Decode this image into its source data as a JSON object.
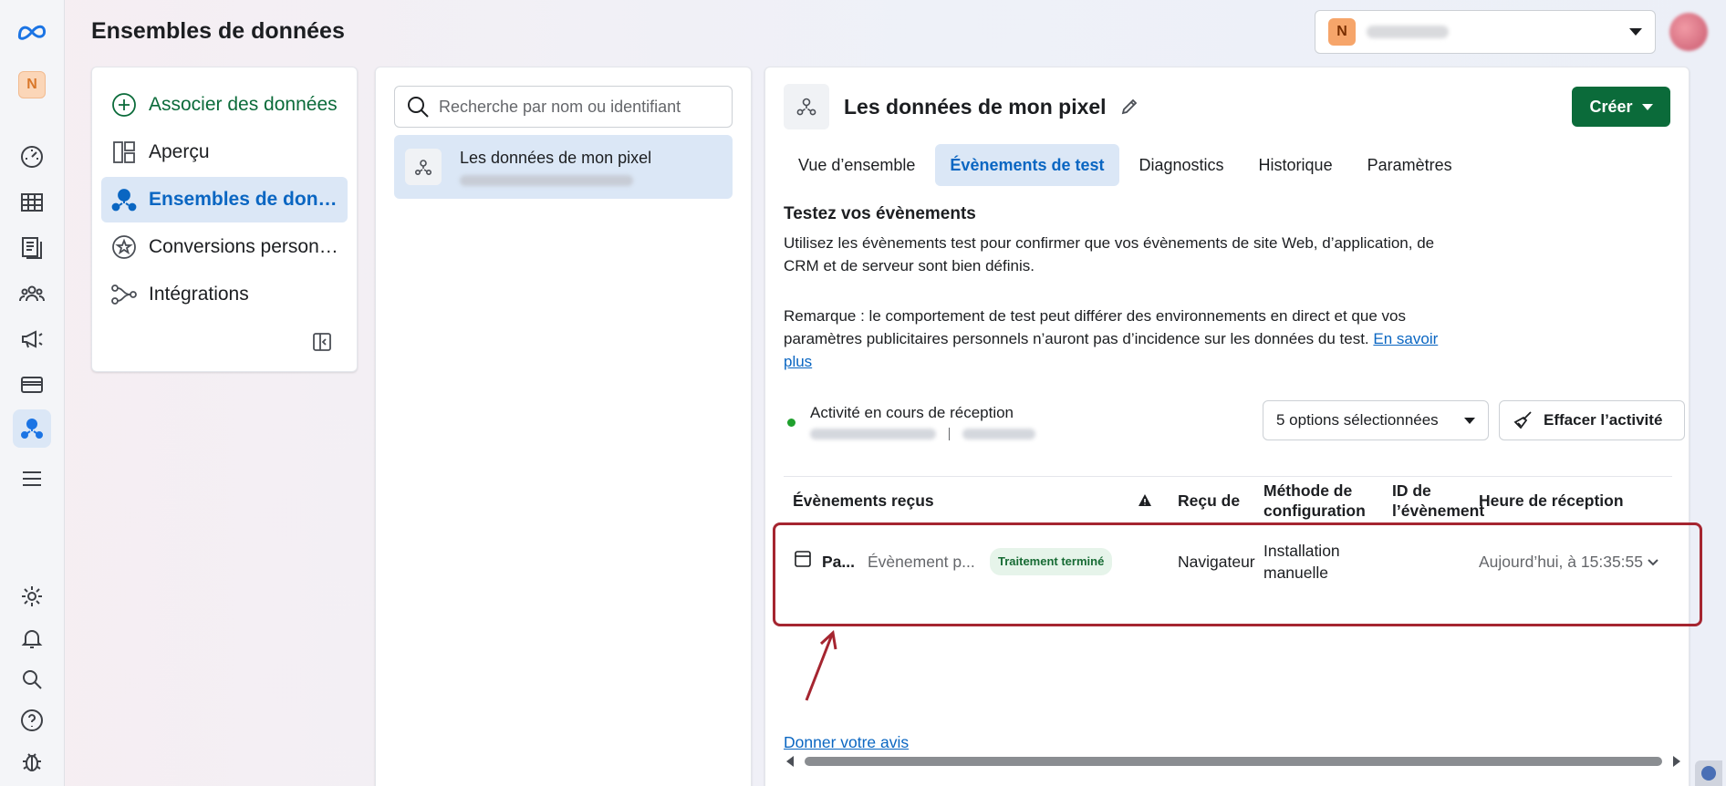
{
  "page_title": "Ensembles de données",
  "rail": {
    "account_initial": "N"
  },
  "topbar": {
    "account_initial": "N"
  },
  "nav": {
    "items": [
      {
        "label": "Associer des données",
        "icon": "plus-circle-icon"
      },
      {
        "label": "Aperçu",
        "icon": "overview-layout-icon"
      },
      {
        "label": "Ensembles de données",
        "icon": "dataset-icon"
      },
      {
        "label": "Conversions personnalisées",
        "icon": "star-circle-icon"
      },
      {
        "label": "Intégrations",
        "icon": "integrations-icon"
      }
    ]
  },
  "list": {
    "search_placeholder": "Recherche par nom ou identifiant",
    "dataset_name": "Les données de mon pixel"
  },
  "main": {
    "title": "Les données de mon pixel",
    "create_label": "Créer",
    "tabs": [
      "Vue d’ensemble",
      "Évènements de test",
      "Diagnostics",
      "Historique",
      "Paramètres"
    ],
    "active_tab": "Évènements de test",
    "section_title": "Testez vos évènements",
    "description": "Utilisez les évènements test pour confirmer que vos évènements de site Web, d’application, de CRM et de serveur sont bien définis.",
    "note": "Remarque : le comportement de test peut différer des environnements en direct et que vos paramètres publicitaires personnels n’auront pas d’incidence sur les données du test.",
    "learn_more": "En savoir plus",
    "activity_status": "Activité en cours de réception",
    "options_label": "5 options sélectionnées",
    "clear_label": "Effacer l’activité",
    "table": {
      "headers": {
        "events": "Évènements reçus",
        "received_from": "Reçu de",
        "method_l1": "Méthode de",
        "method_l2": "configuration",
        "eventid_l1": "ID de",
        "eventid_l2": "l’évènement",
        "time": "Heure de réception"
      },
      "rows": [
        {
          "name": "Pa...",
          "type": "Évènement p...",
          "status": "Traitement terminé",
          "received_from": "Navigateur",
          "method_l1": "Installation",
          "method_l2": "manuelle",
          "time": "Aujourd’hui, à 15:35:55"
        }
      ]
    },
    "feedback": "Donner votre avis"
  },
  "colors": {
    "accent_blue": "#0a66c2",
    "create_green": "#0b6b3a",
    "highlight_red": "#a52530",
    "status_green": "#1fa02d"
  }
}
